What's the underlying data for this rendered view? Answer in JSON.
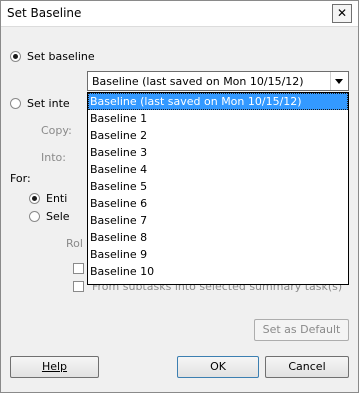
{
  "dialog": {
    "title": "Set Baseline",
    "close_glyph": "✕"
  },
  "set_baseline": {
    "label": "Set baseline",
    "selected": "Baseline (last saved on Mon 10/15/12)",
    "options": [
      "Baseline (last saved on Mon 10/15/12)",
      "Baseline 1",
      "Baseline 2",
      "Baseline 3",
      "Baseline 4",
      "Baseline 5",
      "Baseline 6",
      "Baseline 7",
      "Baseline 8",
      "Baseline 9",
      "Baseline 10"
    ]
  },
  "set_interim": {
    "label_partial": "Set inte",
    "copy_label": "Copy:",
    "into_label": "Into:"
  },
  "for_section": {
    "label": "For:",
    "entire_partial": "Enti",
    "selected_partial": "Sele",
    "rollup_partial": "Rol",
    "from_subtasks_label": "From subtasks into selected summary task(s)"
  },
  "buttons": {
    "set_default": "Set as Default",
    "help": "Help",
    "ok": "OK",
    "cancel": "Cancel"
  }
}
